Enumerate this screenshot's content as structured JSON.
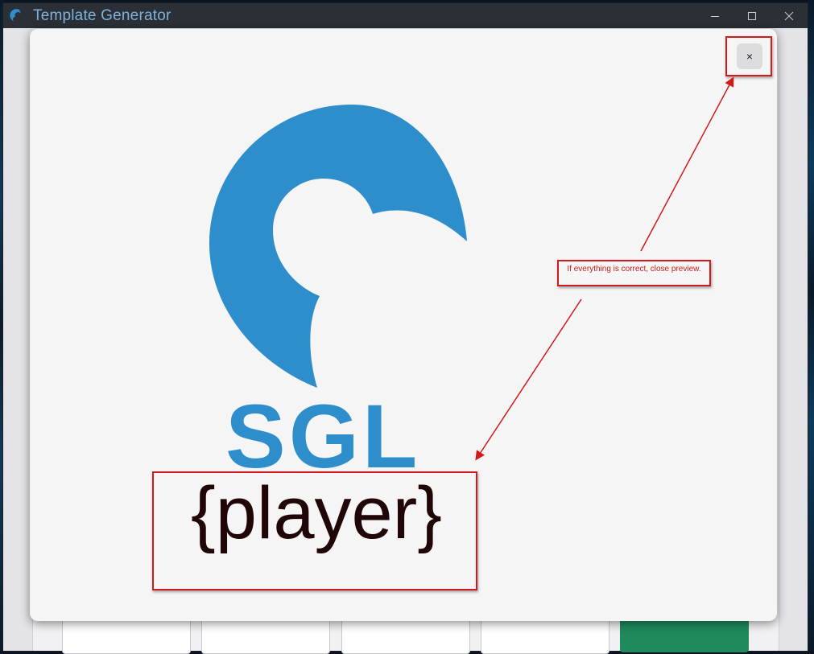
{
  "window": {
    "title": "Template Generator",
    "icon": "sgl-logo-icon",
    "controls": [
      "minimize-icon",
      "maximize-icon",
      "close-icon"
    ]
  },
  "preview": {
    "close_label": "×",
    "logo_text": "SGL",
    "placeholder": "{player}"
  },
  "annotation": {
    "note": "If everything is correct, close preview."
  },
  "colors": {
    "accent_blue": "#2e8ecb",
    "annotation_red": "#d11a1a",
    "titlebar": "#2b2f36",
    "title_text": "#7fb2d9",
    "green_button": "#1f8a5b"
  }
}
